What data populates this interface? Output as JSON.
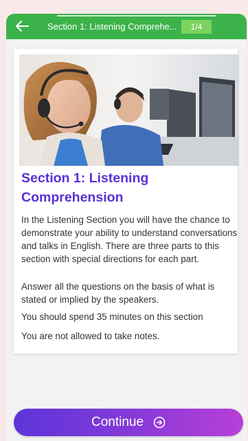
{
  "header": {
    "title": "Section 1: Listening Comprehe...",
    "progress": "1/4",
    "back_icon": "arrow-left-icon",
    "color": "#3cb34a",
    "badge_color": "#7bd45e"
  },
  "card": {
    "image_alt": "Headset call center workers at computers",
    "heading": "Section 1: Listening Comprehension",
    "heading_color": "#5b2fd6",
    "paragraphs": [
      "In the Listening Section you will have the chance to demonstrate your ability to understand conversations and talks in English. There are three parts to this section with special directions for each part.",
      "Answer all the questions on the basis of what is stated or implied by the speakers.",
      "You should spend 35 minutes on this section",
      "You are not allowed to take notes."
    ]
  },
  "footer": {
    "continue_label": "Continue",
    "continue_icon": "arrow-circle-right-icon",
    "gradient_start": "#5b35d9",
    "gradient_end": "#b83fd8"
  }
}
